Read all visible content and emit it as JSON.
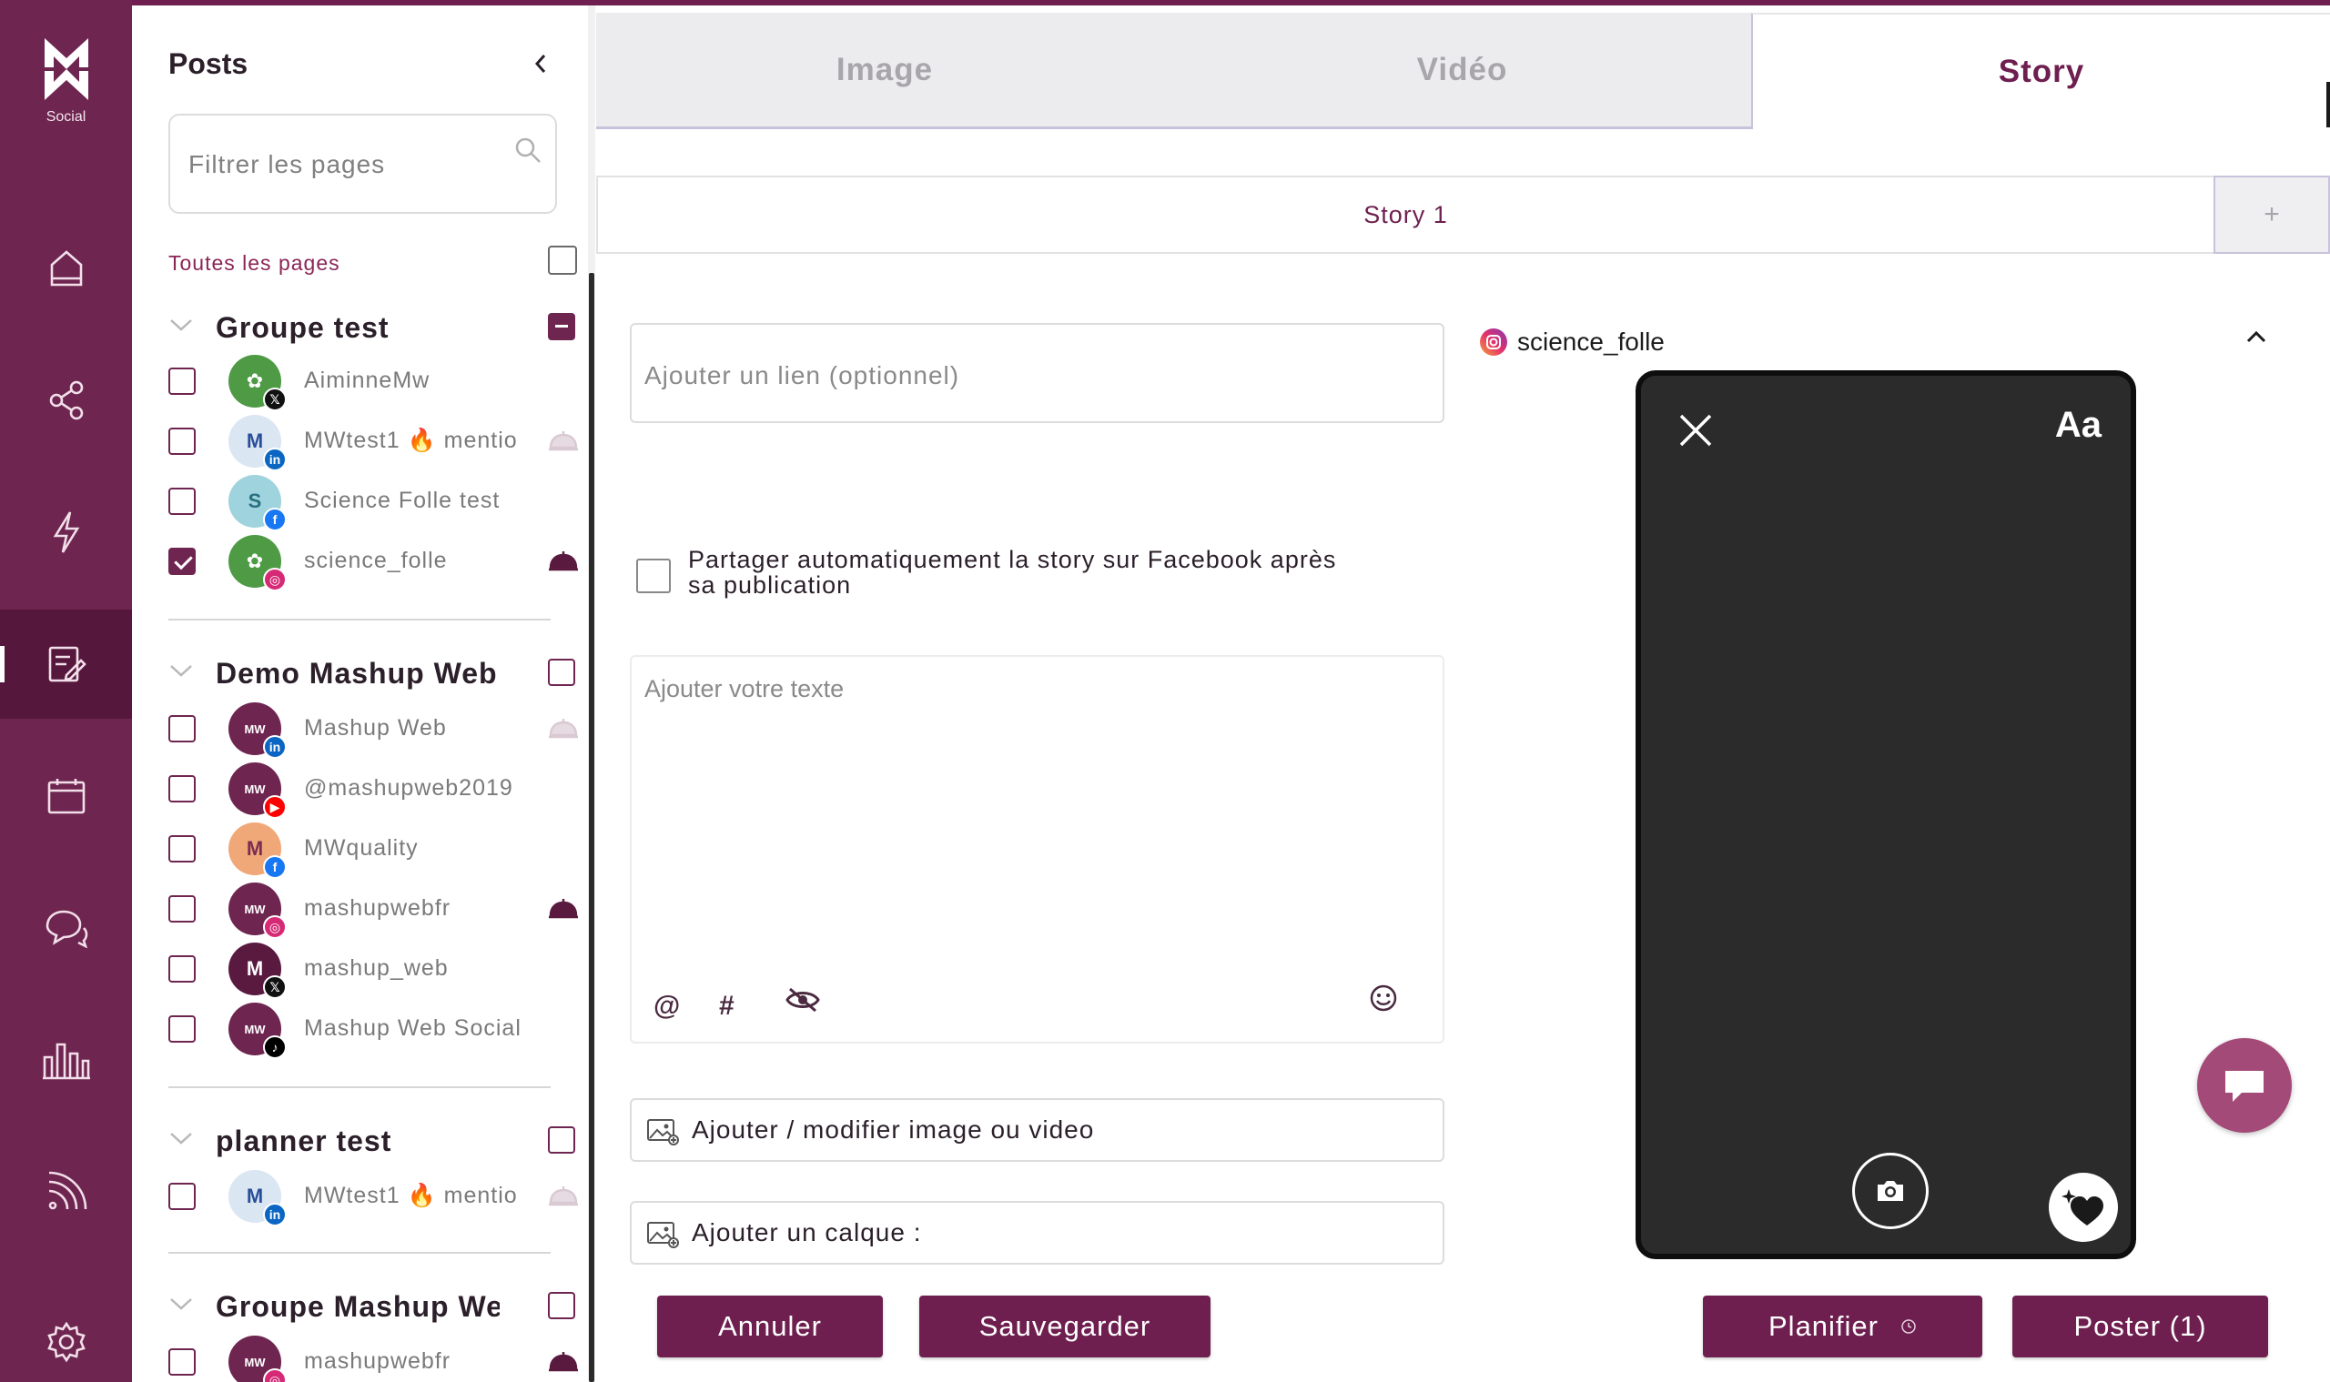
{
  "brand": {
    "logo_label": "Social",
    "primary_color": "#6e1f4f"
  },
  "rail": [
    {
      "name": "home-icon"
    },
    {
      "name": "share-icon"
    },
    {
      "name": "lightning-icon"
    },
    {
      "name": "edit-post-icon",
      "active": true
    },
    {
      "name": "calendar-icon"
    },
    {
      "name": "chat-icon"
    },
    {
      "name": "stats-icon"
    },
    {
      "name": "rss-icon"
    },
    {
      "name": "settings-icon"
    }
  ],
  "sidebar": {
    "title": "Posts",
    "filter_placeholder": "Filtrer les pages",
    "all_pages_label": "Toutes les pages",
    "groups": [
      {
        "name": "Groupe test",
        "state": "partial",
        "accounts": [
          {
            "name": "AiminneMw",
            "network": "x",
            "checked": false
          },
          {
            "name": "MWtest1 🔥 mentio",
            "network": "linkedin",
            "checked": false
          },
          {
            "name": "Science Folle test",
            "network": "facebook",
            "checked": false
          },
          {
            "name": "science_folle",
            "network": "instagram",
            "checked": true
          }
        ]
      },
      {
        "name": "Demo Mashup Web",
        "state": "none",
        "accounts": [
          {
            "name": "Mashup Web",
            "network": "linkedin",
            "checked": false
          },
          {
            "name": "@mashupweb2019",
            "network": "youtube",
            "checked": false
          },
          {
            "name": "MWquality",
            "network": "facebook",
            "checked": false
          },
          {
            "name": "mashupwebfr",
            "network": "instagram",
            "checked": false
          },
          {
            "name": "mashup_web",
            "network": "x",
            "checked": false
          },
          {
            "name": "Mashup Web Social",
            "network": "tiktok",
            "checked": false
          }
        ]
      },
      {
        "name": "planner test",
        "state": "none",
        "accounts": [
          {
            "name": "MWtest1 🔥 mentio",
            "network": "linkedin",
            "checked": false
          }
        ]
      },
      {
        "name": "Groupe Mashup Web",
        "state": "none",
        "accounts": [
          {
            "name": "mashupwebfr",
            "network": "instagram",
            "checked": false
          }
        ]
      }
    ]
  },
  "tabs": [
    {
      "label": "Image",
      "active": false
    },
    {
      "label": "Vidéo",
      "active": false
    },
    {
      "label": "Story",
      "active": true
    }
  ],
  "story_tabs": {
    "current": "Story 1",
    "add_label": "+"
  },
  "form": {
    "link_placeholder": "Ajouter un lien (optionnel)",
    "share_facebook_label": "Partager automatiquement la story sur Facebook après sa publication",
    "text_placeholder": "Ajouter votre texte",
    "mention_symbol": "@",
    "hashtag_symbol": "#",
    "media_button": "Ajouter / modifier image ou video",
    "layer_button": "Ajouter un calque :"
  },
  "actions": {
    "cancel": "Annuler",
    "save": "Sauvegarder",
    "schedule": "Planifier",
    "post": "Poster (1)"
  },
  "preview": {
    "account": "science_folle",
    "text_tool": "Aa"
  }
}
